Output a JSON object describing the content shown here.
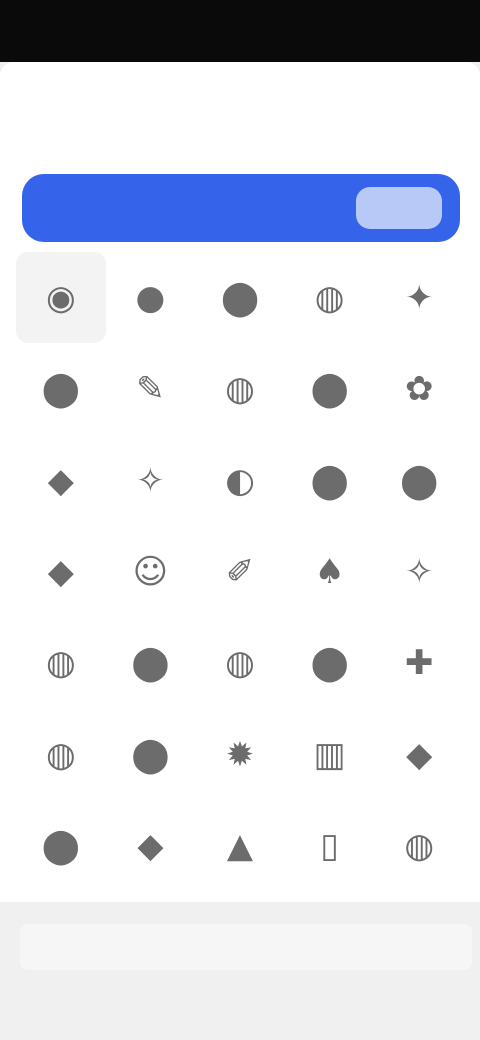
{
  "status_bar": {
    "time": "",
    "indicators": ""
  },
  "nav": {
    "left_label": "",
    "title": "",
    "right_label": ""
  },
  "search": {
    "placeholder": "",
    "button_label": ""
  },
  "grid": {
    "rows": 7,
    "columns": 5,
    "glyphs": [
      "◉",
      "●",
      "⬤",
      "◍",
      "✦",
      "⬤",
      "✎",
      "◍",
      "⬤",
      "✿",
      "◆",
      "✧",
      "◐",
      "⬤",
      "⬤",
      "◆",
      "☺",
      "✐",
      "♠",
      "✧",
      "◍",
      "⬤",
      "◍",
      "⬤",
      "✚",
      "◍",
      "⬤",
      "✹",
      "▥",
      "◆",
      "⬤",
      "◆",
      "▲",
      "▯",
      "◍"
    ],
    "selected_index": 0
  },
  "footer": {
    "text": ""
  },
  "colors": {
    "accent": "#3563e9",
    "status_bar": "#0a0a0a",
    "glyph": "#6c6c6c"
  }
}
